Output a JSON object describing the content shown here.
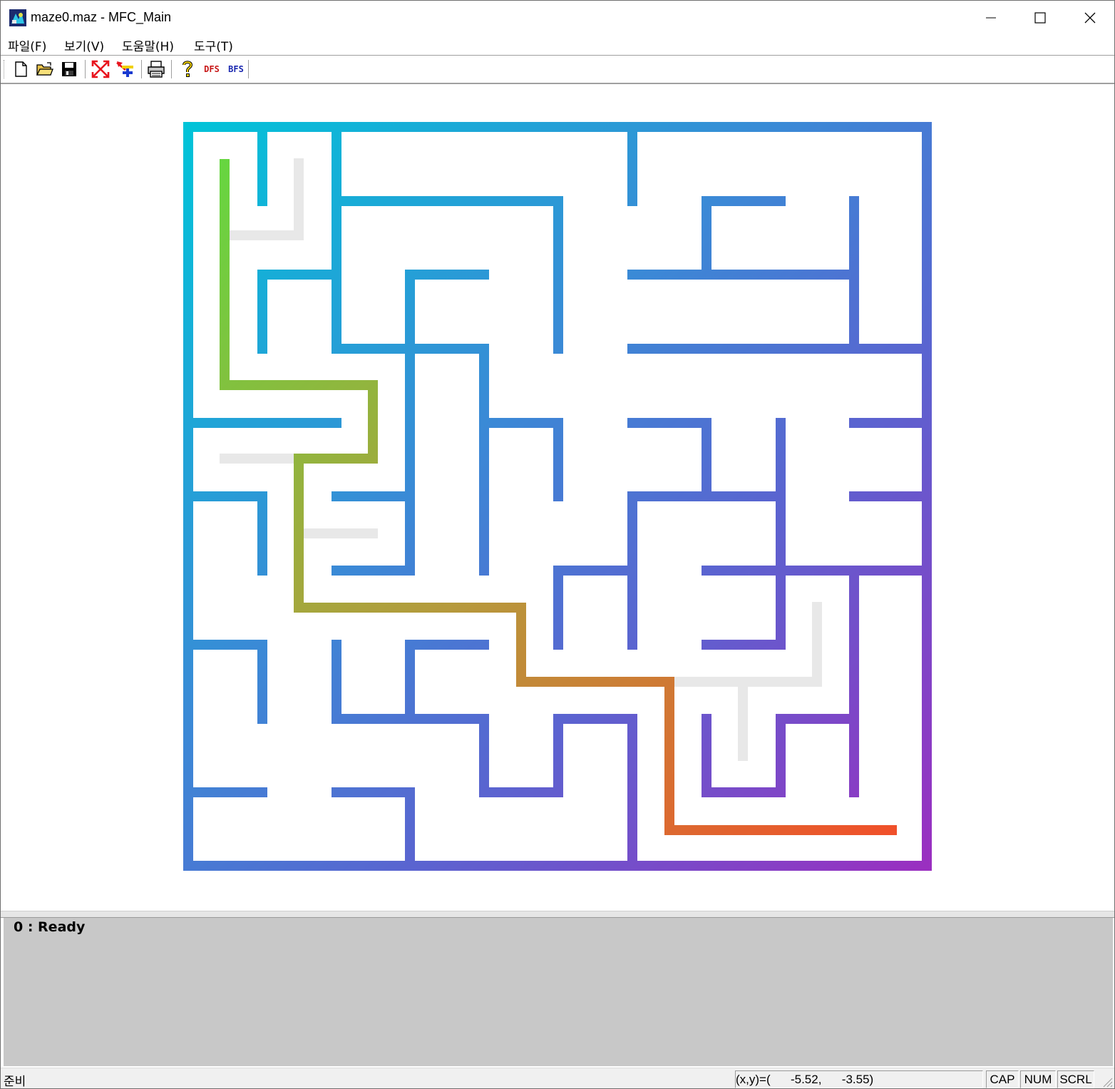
{
  "window": {
    "title": "maze0.maz - MFC_Main",
    "controls": {
      "minimize": "minimize-icon",
      "maximize": "maximize-icon",
      "close": "close-icon"
    }
  },
  "menu": [
    "파일(F)",
    "보기(V)",
    "도움말(H)",
    "도구(T)"
  ],
  "toolbar": {
    "icons": [
      "new-file-icon",
      "open-folder-icon",
      "save-disk-icon",
      "shrink-arrows-icon",
      "add-cross-icon",
      "print-icon",
      "help-question-icon"
    ],
    "dfs_label": "DFS",
    "bfs_label": "BFS"
  },
  "maze": {
    "grid_size": 10,
    "wall_gradient": [
      "#00c4d8",
      "#3a8ad6",
      "#5a64d0",
      "#9b2ec0"
    ],
    "path_gradient": [
      "#66d640",
      "#b59a3c",
      "#f0502a"
    ],
    "visited_color": "#e8e8e8"
  },
  "output": {
    "line": "0 : Ready"
  },
  "status": {
    "main": "준비",
    "coords": "(x,y)=(      -5.52,      -3.55)",
    "cap": "CAP",
    "num": "NUM",
    "scrl": "SCRL"
  }
}
